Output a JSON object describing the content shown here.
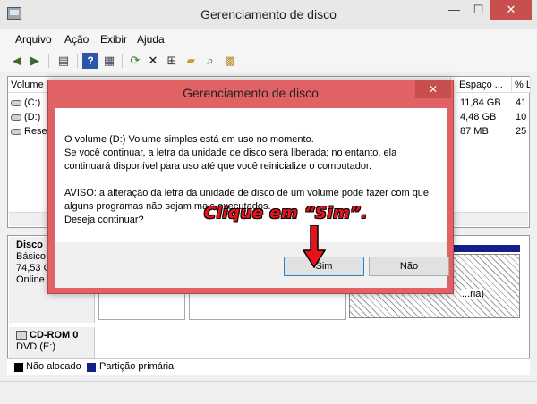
{
  "window": {
    "title": "Gerenciamento de disco",
    "min_glyph": "—",
    "max_glyph": "☐",
    "close_glyph": "✕"
  },
  "menu": [
    "Arquivo",
    "Ação",
    "Exibir",
    "Ajuda"
  ],
  "toolbar": {
    "icons": [
      "back-arrow-icon",
      "forward-arrow-icon",
      "list-view-icon",
      "help-icon",
      "properties-icon",
      "refresh-icon",
      "delete-icon",
      "connect-icon",
      "open-folder-icon",
      "search-icon",
      "settings-icon"
    ]
  },
  "volume_list": {
    "columns": [
      "Volume",
      "Espaço ...",
      "% L"
    ],
    "rows": [
      {
        "name": "(C:)",
        "space": "11,84 GB",
        "pct": "41"
      },
      {
        "name": "(D:)",
        "space": "4,48 GB",
        "pct": "10"
      },
      {
        "name": "Reser",
        "space": "87 MB",
        "pct": "25"
      }
    ]
  },
  "disks": [
    {
      "name": "Disco",
      "type": "Básico",
      "size": "74,53 G",
      "status": "Online",
      "partition_text": "...ria)"
    },
    {
      "name": "CD-ROM 0",
      "type": "DVD (E:)"
    }
  ],
  "legend": [
    {
      "label": "Não alocado",
      "color": "#000000"
    },
    {
      "label": "Partição primária",
      "color": "#141f8c"
    }
  ],
  "dialog": {
    "title": "Gerenciamento de disco",
    "close_glyph": "✕",
    "line1": "O volume  (D:) Volume simples está em uso no momento.",
    "line2": " Se você continuar, a letra da unidade de disco será liberada; no entanto, ela continuará disponível para uso até que você reinicialize o computador.",
    "warning": "AVISO: a alteração da letra da unidade de disco de um volume pode fazer com que alguns programas não sejam mais executados.",
    "question": "Deseja continuar?",
    "yes_label": "Sim",
    "no_label": "Não"
  },
  "annotation": {
    "text": "Clique em “Sim”.",
    "color": "#e8131a"
  },
  "colors": {
    "dialog_frame": "#e06264",
    "close_button": "#c7504e",
    "partition_blue": "#141f8c"
  }
}
